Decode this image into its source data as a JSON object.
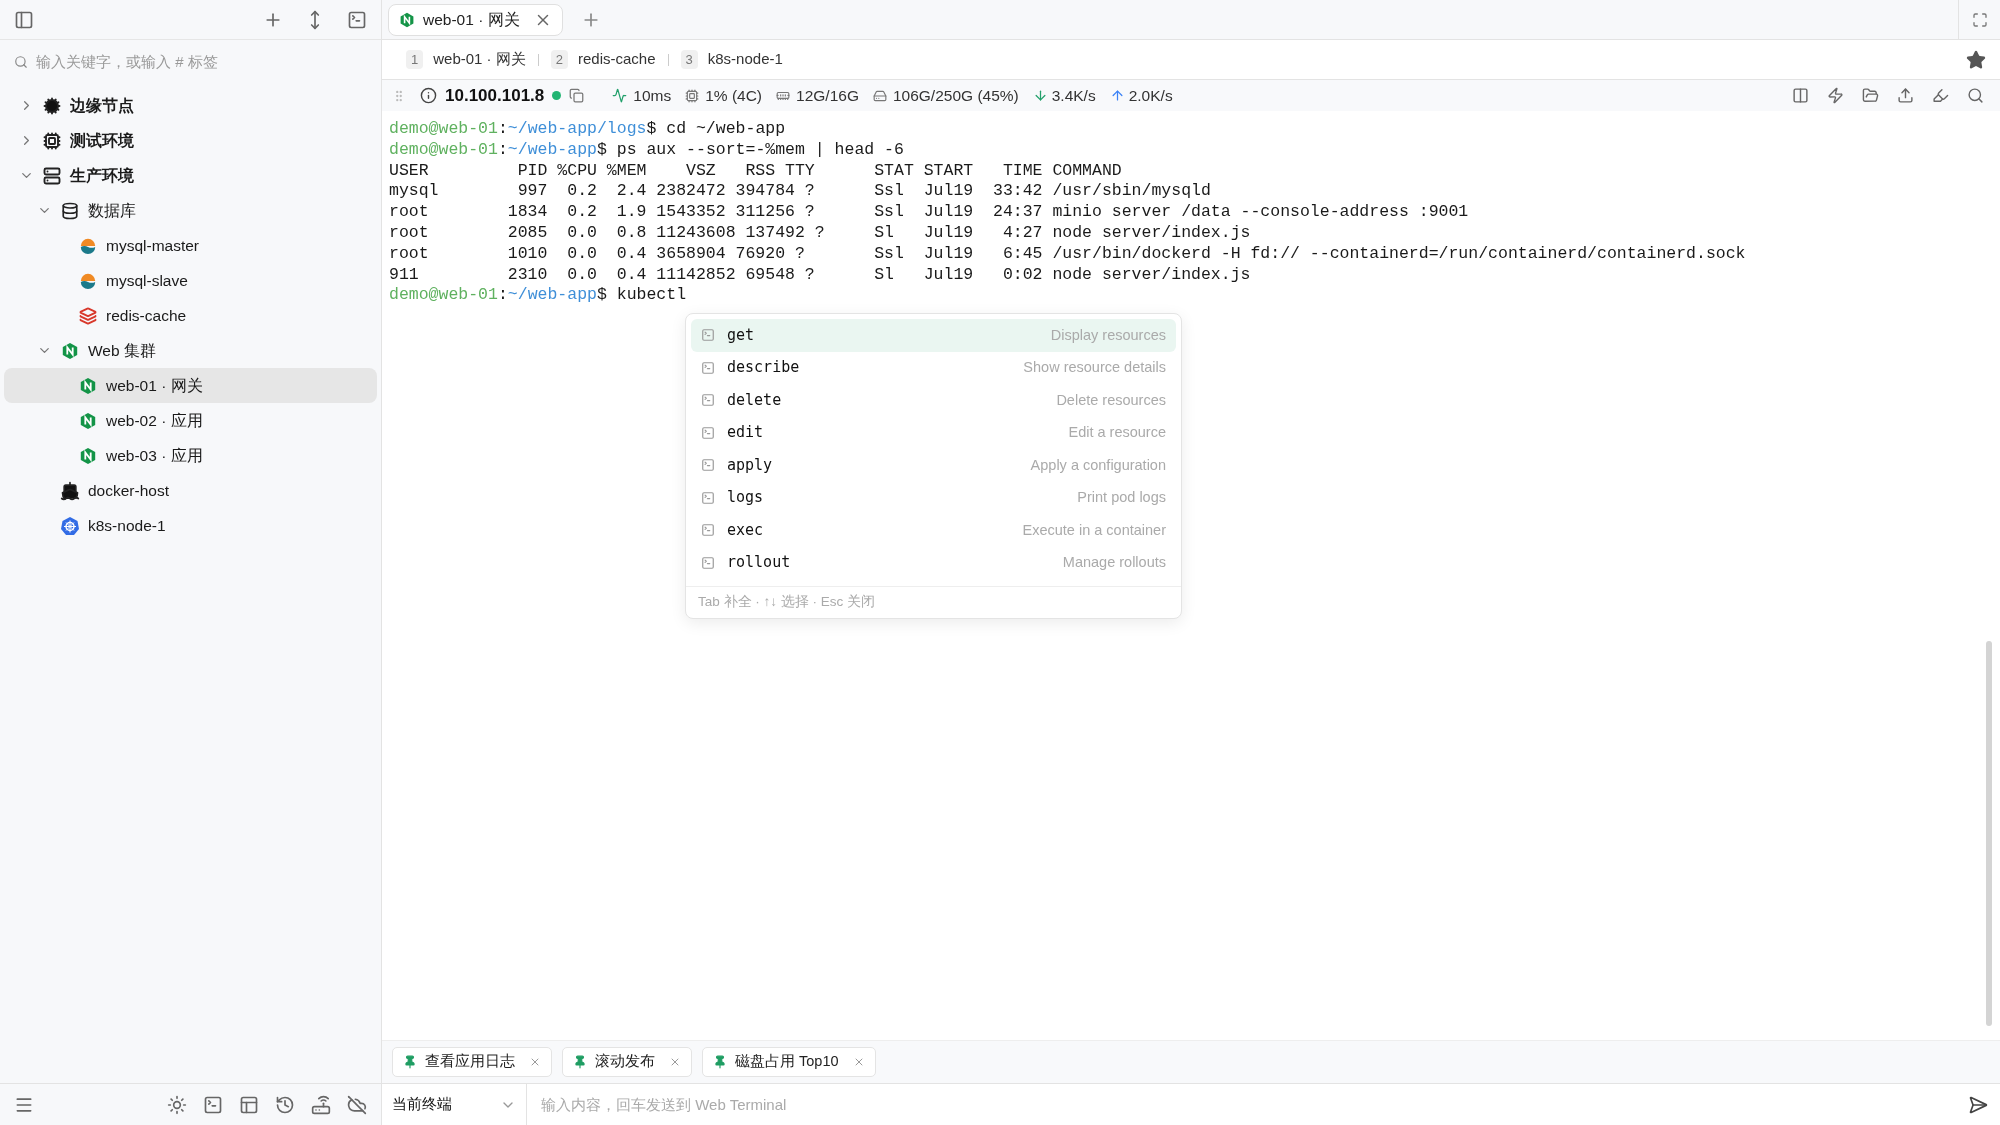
{
  "sidebar": {
    "search": {
      "placeholder": "输入关键字，或输入 # 标签"
    },
    "tree": [
      {
        "label": "边缘节点",
        "kind": "cloud",
        "expanded": false,
        "selected": false
      },
      {
        "label": "测试环境",
        "kind": "chip",
        "expanded": false,
        "selected": false
      },
      {
        "label": "生产环境",
        "kind": "server",
        "expanded": true,
        "selected": false,
        "children": [
          {
            "label": "数据库",
            "kind": "database",
            "expanded": true,
            "selected": false,
            "children": [
              {
                "label": "mysql-master",
                "kind": "mysql",
                "selected": false
              },
              {
                "label": "mysql-slave",
                "kind": "mysql",
                "selected": false
              },
              {
                "label": "redis-cache",
                "kind": "redis",
                "selected": false
              }
            ]
          },
          {
            "label": "Web 集群",
            "kind": "nginx",
            "expanded": true,
            "selected": false,
            "children": [
              {
                "label": "web-01 · 网关",
                "kind": "nginx",
                "selected": true
              },
              {
                "label": "web-02 · 应用",
                "kind": "nginx",
                "selected": false
              },
              {
                "label": "web-03 · 应用",
                "kind": "nginx",
                "selected": false
              }
            ]
          },
          {
            "label": "docker-host",
            "kind": "docker",
            "selected": false
          },
          {
            "label": "k8s-node-1",
            "kind": "k8s",
            "selected": false
          }
        ]
      }
    ]
  },
  "session_tabs": [
    {
      "label": "web-01 · 网关",
      "selected": true
    }
  ],
  "recent_tabs": [
    {
      "index": "1",
      "label": "web-01 · 网关"
    },
    {
      "index": "2",
      "label": "redis-cache"
    },
    {
      "index": "3",
      "label": "k8s-node-1"
    }
  ],
  "status": {
    "host": "10.100.101.8",
    "online": true,
    "latency": "10ms",
    "cpu": "1% (4C)",
    "memory": "12G/16G",
    "disk": "106G/250G (45%)",
    "download": "3.4K/s",
    "upload": "2.0K/s"
  },
  "terminal": {
    "lines": [
      {
        "kind": "prompt",
        "user": "demo@web-01",
        "colon": ":",
        "path": "~/web-app/logs",
        "dollar": "$",
        "command": " cd ~/web-app"
      },
      {
        "kind": "prompt",
        "user": "demo@web-01",
        "colon": ":",
        "path": "~/web-app",
        "dollar": "$",
        "command": " ps aux --sort=-%mem | head -6"
      },
      {
        "kind": "output",
        "text": "USER         PID %CPU %MEM    VSZ   RSS TTY      STAT START   TIME COMMAND"
      },
      {
        "kind": "output",
        "text": "mysql        997  0.2  2.4 2382472 394784 ?      Ssl  Jul19  33:42 /usr/sbin/mysqld"
      },
      {
        "kind": "output",
        "text": "root        1834  0.2  1.9 1543352 311256 ?      Ssl  Jul19  24:37 minio server /data --console-address :9001"
      },
      {
        "kind": "output",
        "text": "root        2085  0.0  0.8 11243608 137492 ?     Sl   Jul19   4:27 node server/index.js"
      },
      {
        "kind": "output",
        "text": "root        1010  0.0  0.4 3658904 76920 ?       Ssl  Jul19   6:45 /usr/bin/dockerd -H fd:// --containerd=/run/containerd/containerd.sock"
      },
      {
        "kind": "output",
        "text": "911         2310  0.0  0.4 11142852 69548 ?      Sl   Jul19   0:02 node server/index.js"
      },
      {
        "kind": "prompt",
        "user": "demo@web-01",
        "colon": ":",
        "path": "~/web-app",
        "dollar": "$",
        "command": " kubectl"
      }
    ],
    "completion": {
      "items": [
        {
          "command": "get",
          "description": "Display resources",
          "selected": true
        },
        {
          "command": "describe",
          "description": "Show resource details",
          "selected": false
        },
        {
          "command": "delete",
          "description": "Delete resources",
          "selected": false
        },
        {
          "command": "edit",
          "description": "Edit a resource",
          "selected": false
        },
        {
          "command": "apply",
          "description": "Apply a configuration",
          "selected": false
        },
        {
          "command": "logs",
          "description": "Print pod logs",
          "selected": false
        },
        {
          "command": "exec",
          "description": "Execute in a container",
          "selected": false
        },
        {
          "command": "rollout",
          "description": "Manage rollouts",
          "selected": false
        }
      ],
      "hint": "Tab 补全 · ↑↓ 选择 · Esc 关闭"
    }
  },
  "quick_commands": [
    "查看应用日志",
    "滚动发布",
    "磁盘占用 Top10"
  ],
  "input_bar": {
    "target": "当前终端",
    "placeholder": "输入内容，回车发送到 Web Terminal"
  }
}
